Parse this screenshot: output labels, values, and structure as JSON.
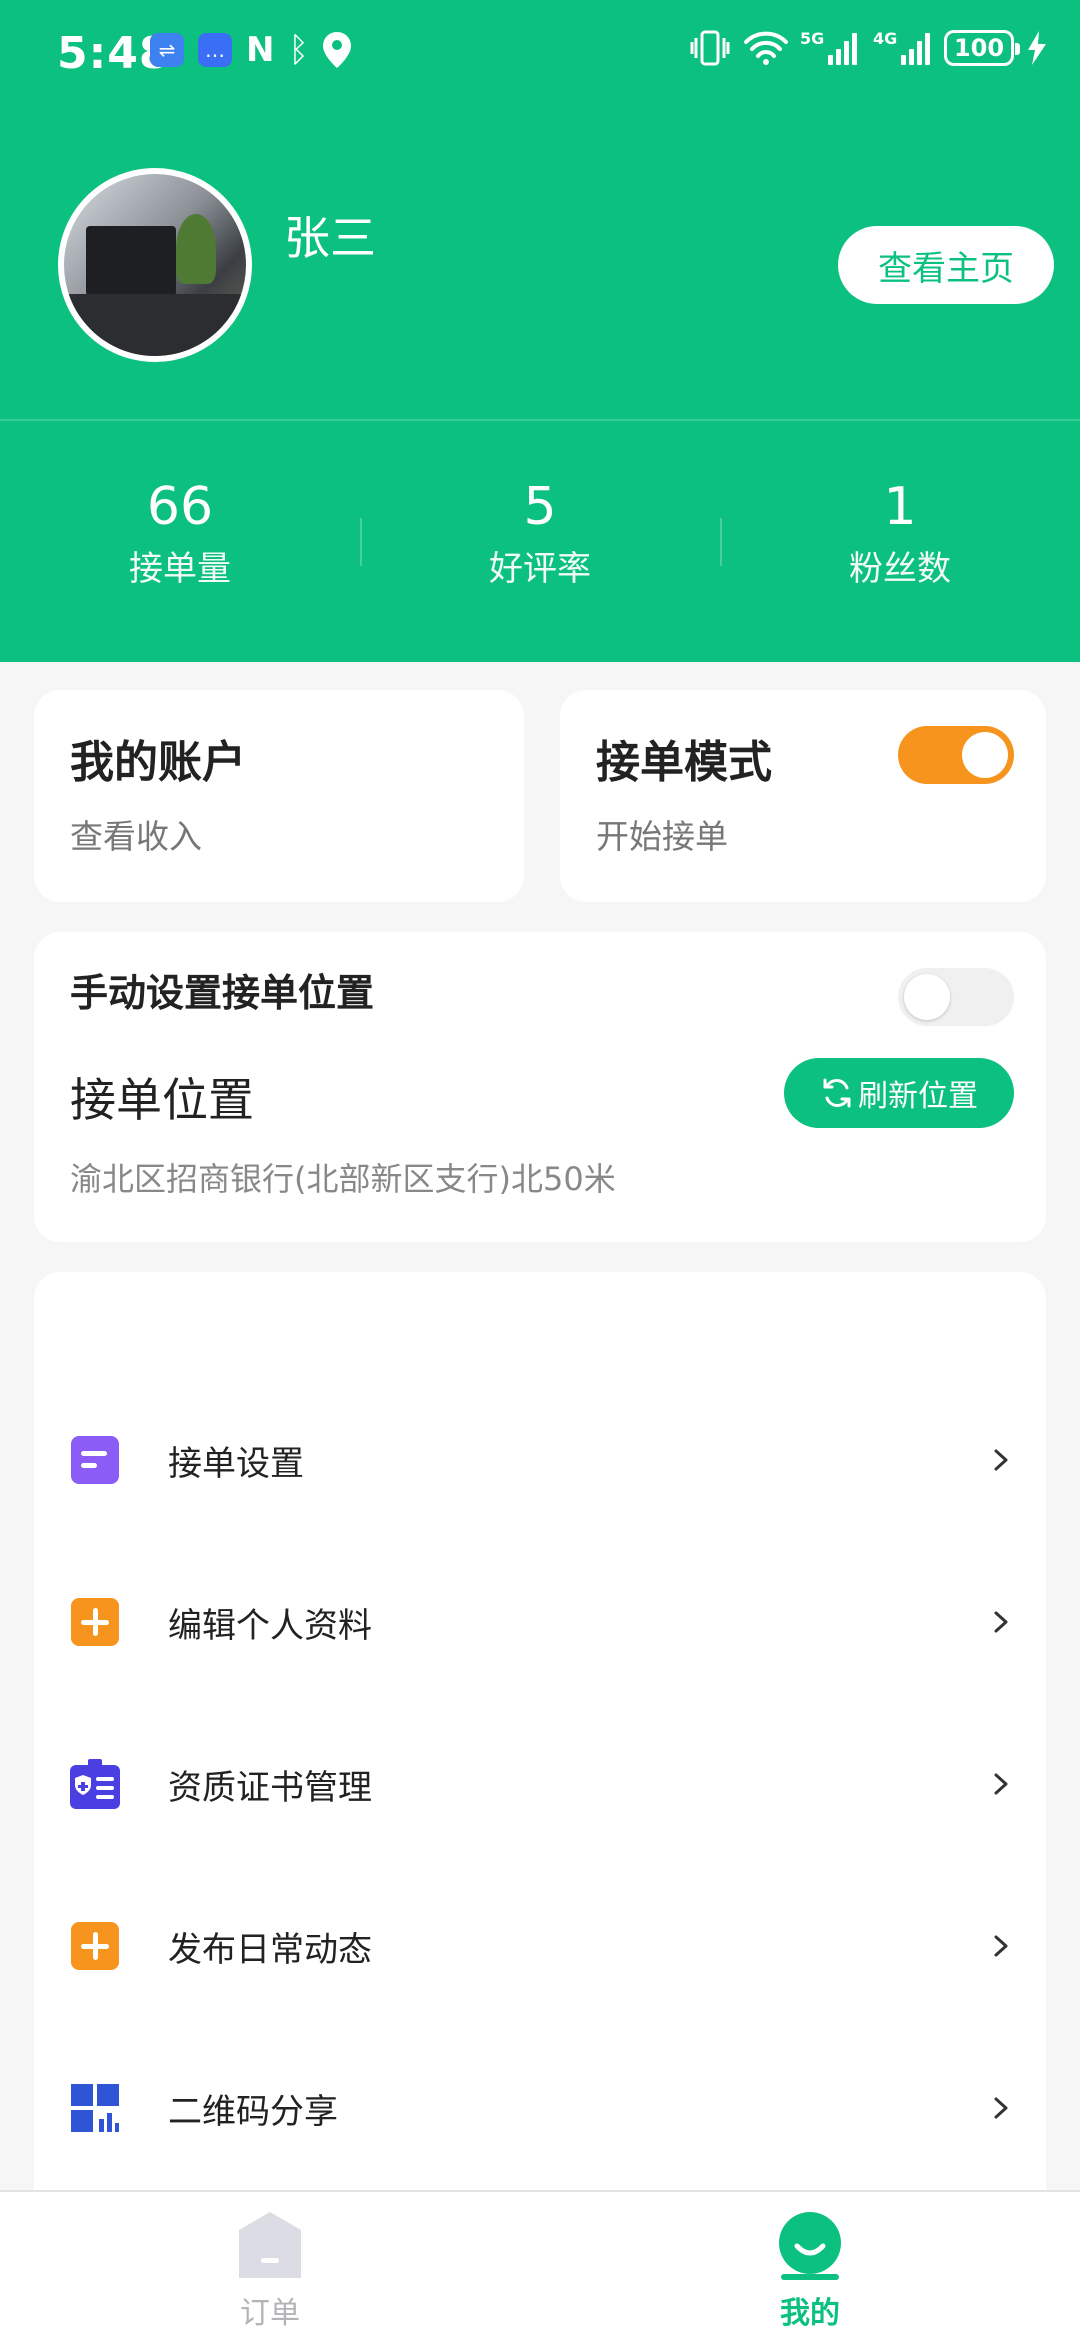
{
  "status_bar": {
    "time": "5:48",
    "battery": "100",
    "signal_1": "5G",
    "signal_2": "4G"
  },
  "profile": {
    "name": "张三",
    "view_home_label": "查看主页"
  },
  "stats": [
    {
      "value": "66",
      "label": "接单量"
    },
    {
      "value": "5",
      "label": "好评率"
    },
    {
      "value": "1",
      "label": "粉丝数"
    }
  ],
  "account_card": {
    "title": "我的账户",
    "subtitle": "查看收入"
  },
  "order_mode_card": {
    "title": "接单模式",
    "subtitle": "开始接单",
    "enabled": true
  },
  "location_card": {
    "manual_title": "手动设置接单位置",
    "manual_enabled": false,
    "location_title": "接单位置",
    "refresh_label": "刷新位置",
    "address": "渝北区招商银行(北部新区支行)北50米"
  },
  "menu": [
    {
      "label": "接单设置",
      "icon": "order-settings-icon",
      "color": "#8b5cf6"
    },
    {
      "label": "编辑个人资料",
      "icon": "plus-icon",
      "color": "#f7941e"
    },
    {
      "label": "资质证书管理",
      "icon": "certificate-icon",
      "color": "#4a3fe0"
    },
    {
      "label": "发布日常动态",
      "icon": "plus-icon",
      "color": "#f7941e"
    },
    {
      "label": "二维码分享",
      "icon": "qrcode-icon",
      "color": "#2f54d6"
    }
  ],
  "tabbar": {
    "orders_label": "订单",
    "mine_label": "我的"
  },
  "colors": {
    "brand": "#0cc07f",
    "accent": "#f7941e"
  }
}
